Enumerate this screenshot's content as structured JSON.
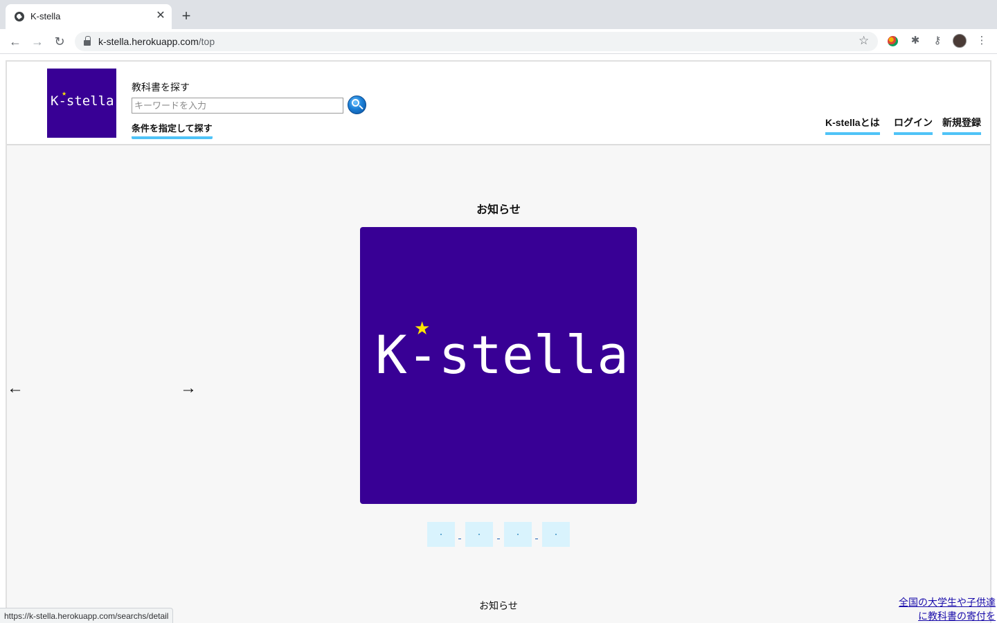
{
  "browser": {
    "tab_title": "K-stella",
    "tab_close": "✕",
    "new_tab": "+",
    "url_host": "k-stella.herokuapp.com",
    "url_path": "/top",
    "status_url": "https://k-stella.herokuapp.com/searchs/detail"
  },
  "header": {
    "logo_text": "K-stella",
    "search_label": "教科書を探す",
    "search_placeholder": "キーワードを入力",
    "search_value": "",
    "advanced_search": "条件を指定して探す",
    "nav": [
      "K-stellaとは",
      "ログイン",
      "新規登録"
    ]
  },
  "main": {
    "section_title": "お知らせ",
    "slide_text": "K-stella",
    "prev_arrow": "←",
    "next_arrow": "→",
    "indicators": 4,
    "bottom_title": "お知らせ",
    "promo_lines": [
      "全国の大学生や子供達",
      "に教科書の寄付を"
    ]
  },
  "colors": {
    "brand_purple": "#380095",
    "accent_blue": "#4fc3f7",
    "star_yellow": "#ffe600",
    "link_blue": "#1a0dab"
  }
}
